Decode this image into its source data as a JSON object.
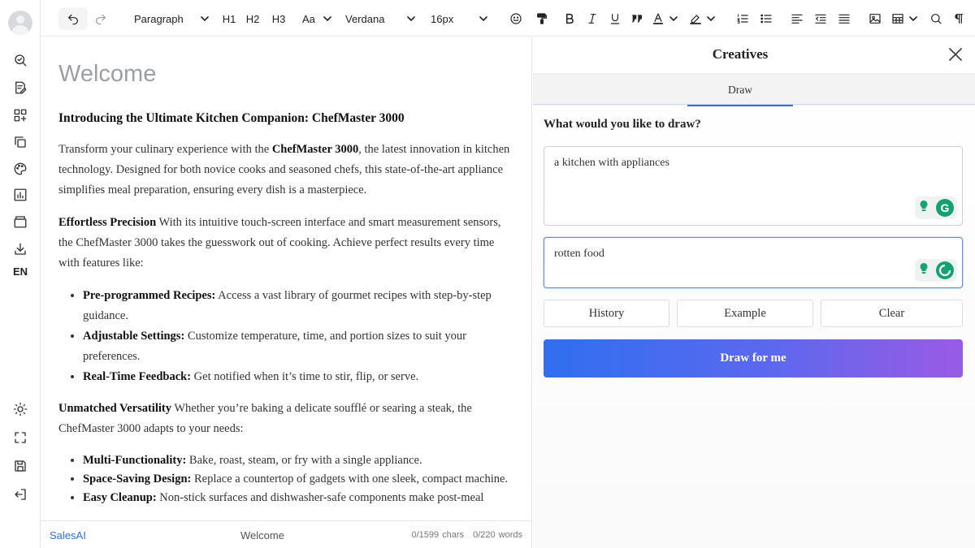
{
  "toolbar": {
    "paragraph_style": "Paragraph",
    "h1": "H1",
    "h2": "H2",
    "h3": "H3",
    "case": "Aa",
    "font": "Verdana",
    "size": "16px"
  },
  "rail": {
    "language": "EN"
  },
  "document": {
    "title": "Welcome",
    "heading": "Introducing the Ultimate Kitchen Companion: ChefMaster 3000",
    "intro_pre": "Transform your culinary experience with the ",
    "intro_bold": "ChefMaster 3000",
    "intro_post": ", the latest innovation in kitchen technology. Designed for both novice cooks and seasoned chefs, this state-of-the-art appliance simplifies meal preparation, ensuring every dish is a masterpiece.",
    "section1_title": "Effortless Precision",
    "section1_text": " With its intuitive touch-screen interface and smart measurement sensors, the ChefMaster 3000 takes the guesswork out of cooking. Achieve perfect results every time with features like:",
    "list1": [
      {
        "bold": "Pre-programmed Recipes:",
        "text": " Access a vast library of gourmet recipes with step-by-step guidance."
      },
      {
        "bold": "Adjustable Settings:",
        "text": " Customize temperature, time, and portion sizes to suit your preferences."
      },
      {
        "bold": "Real-Time Feedback:",
        "text": " Get notified when it’s time to stir, flip, or serve."
      }
    ],
    "section2_title": "Unmatched Versatility",
    "section2_text": " Whether you’re baking a delicate soufflé or searing a steak, the ChefMaster 3000 adapts to your needs:",
    "list2": [
      {
        "bold": "Multi-Functionality:",
        "text": " Bake, roast, steam, or fry with a single appliance."
      },
      {
        "bold": "Space-Saving Design:",
        "text": " Replace a countertop of gadgets with one sleek, compact machine."
      },
      {
        "bold": "Easy Cleanup:",
        "text": " Non-stick surfaces and dishwasher-safe components make post-meal"
      }
    ]
  },
  "statusbar": {
    "brand": "SalesAI",
    "doc_name": "Welcome",
    "chars_count": "0/1599",
    "chars_label": "chars",
    "words_count": "0/220",
    "words_label": "words"
  },
  "panel": {
    "title": "Creatives",
    "tab": "Draw",
    "question": "What would you like to draw?",
    "prompt_value": "a kitchen with appliances",
    "negative_value": "rotten food",
    "history_label": "History",
    "example_label": "Example",
    "clear_label": "Clear",
    "submit_label": "Draw for me",
    "accent_color": "#2f6ff0",
    "grammar_badge_letter": "G"
  }
}
